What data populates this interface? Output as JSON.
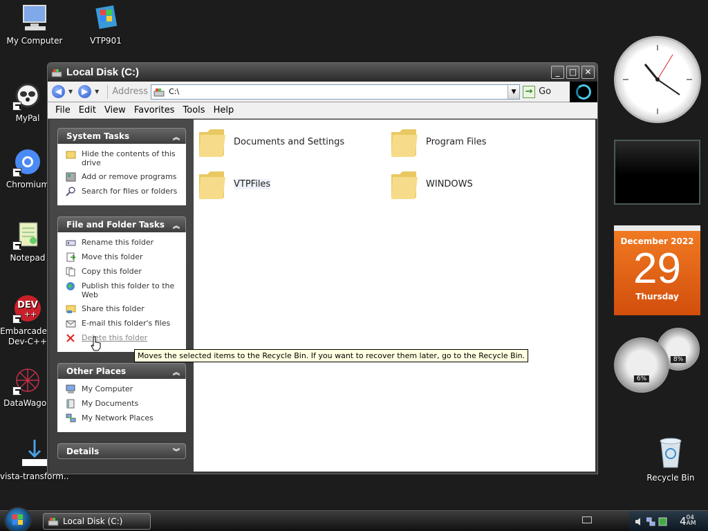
{
  "desktop": {
    "icons": [
      {
        "label": "My Computer"
      },
      {
        "label": "VTP901"
      },
      {
        "label": "MyPal"
      },
      {
        "label": "Chromium"
      },
      {
        "label": "Notepad"
      },
      {
        "label": "Embarcadero Dev-C++"
      },
      {
        "label": "DataWagon"
      },
      {
        "label": "vista-transform..."
      }
    ],
    "recycle_bin": "Recycle Bin"
  },
  "window": {
    "title": "Local Disk (C:)",
    "buttons": {
      "minimize": "_",
      "maximize": "□",
      "close": "✕"
    },
    "address": {
      "label": "Address",
      "value": "C:\\",
      "go": "Go"
    },
    "menu": [
      "File",
      "Edit",
      "View",
      "Favorites",
      "Tools",
      "Help"
    ],
    "system_tasks": {
      "title": "System Tasks",
      "items": [
        "Hide the contents of this drive",
        "Add or remove programs",
        "Search for files or folders"
      ]
    },
    "file_folder_tasks": {
      "title": "File and Folder Tasks",
      "items": [
        "Rename this folder",
        "Move this folder",
        "Copy this folder",
        "Publish this folder to the Web",
        "Share this folder",
        "E-mail this folder's files",
        "Delete this folder"
      ]
    },
    "other_places": {
      "title": "Other Places",
      "items": [
        "My Computer",
        "My Documents",
        "My Network Places"
      ]
    },
    "details": {
      "title": "Details"
    },
    "folders": [
      "Documents and Settings",
      "Program Files",
      "VTPFiles",
      "WINDOWS"
    ],
    "tooltip": "Moves the selected items to the Recycle Bin. If you want to recover them later, go to the Recycle Bin."
  },
  "gadgets": {
    "calendar": {
      "month": "December 2022",
      "day": "29",
      "weekday": "Thursday"
    },
    "cpu_gauge": {
      "cpu": "6%",
      "memory": "8%"
    }
  },
  "taskbar": {
    "active_task": "Local Disk (C:)",
    "time_hour": "4",
    "time_minute": "04",
    "time_ampm": "AM"
  },
  "colors": {
    "calendar_orange": "#e0621a",
    "tooltip_bg": "#ffffe1",
    "accent_blue": "#2b5bc9"
  }
}
